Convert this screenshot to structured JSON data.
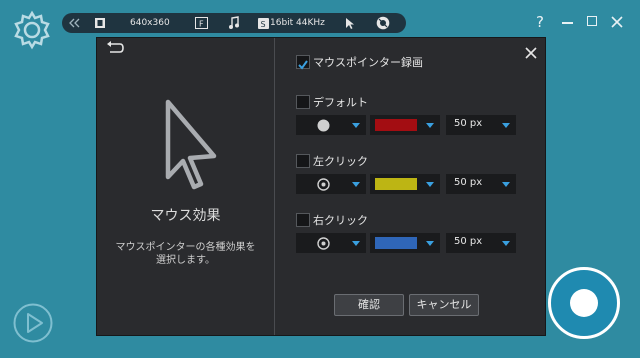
{
  "toolbar": {
    "resolution": "640x360",
    "audio": "16bit 44KHz"
  },
  "dialog": {
    "left": {
      "title": "マウス効果",
      "description_line1": "マウスポインターの各種効果を",
      "description_line2": "選択します。"
    },
    "record_pointer_label": "マウスポインター録画",
    "sections": [
      {
        "label": "デフォルト",
        "shape": "circle-filled",
        "color": "#a30d12",
        "size": "50 px"
      },
      {
        "label": "左クリック",
        "shape": "circle-ring",
        "color": "#bdb514",
        "size": "50 px"
      },
      {
        "label": "右クリック",
        "shape": "circle-ring",
        "color": "#2f66b8",
        "size": "50 px"
      }
    ],
    "ok_label": "確認",
    "cancel_label": "キャンセル"
  },
  "icons": {
    "gear": "gear-icon",
    "play": "play-icon",
    "collapse": "double-chevron-left-icon",
    "film": "film-icon",
    "format": "format-icon",
    "music": "music-note-icon",
    "sound": "sound-icon",
    "cursor": "cursor-icon",
    "webcam": "webcam-icon",
    "help": "help-icon",
    "minimize": "minimize-icon",
    "maximize": "maximize-icon",
    "close": "close-icon",
    "back": "back-arrow-icon",
    "record": "record-button"
  }
}
